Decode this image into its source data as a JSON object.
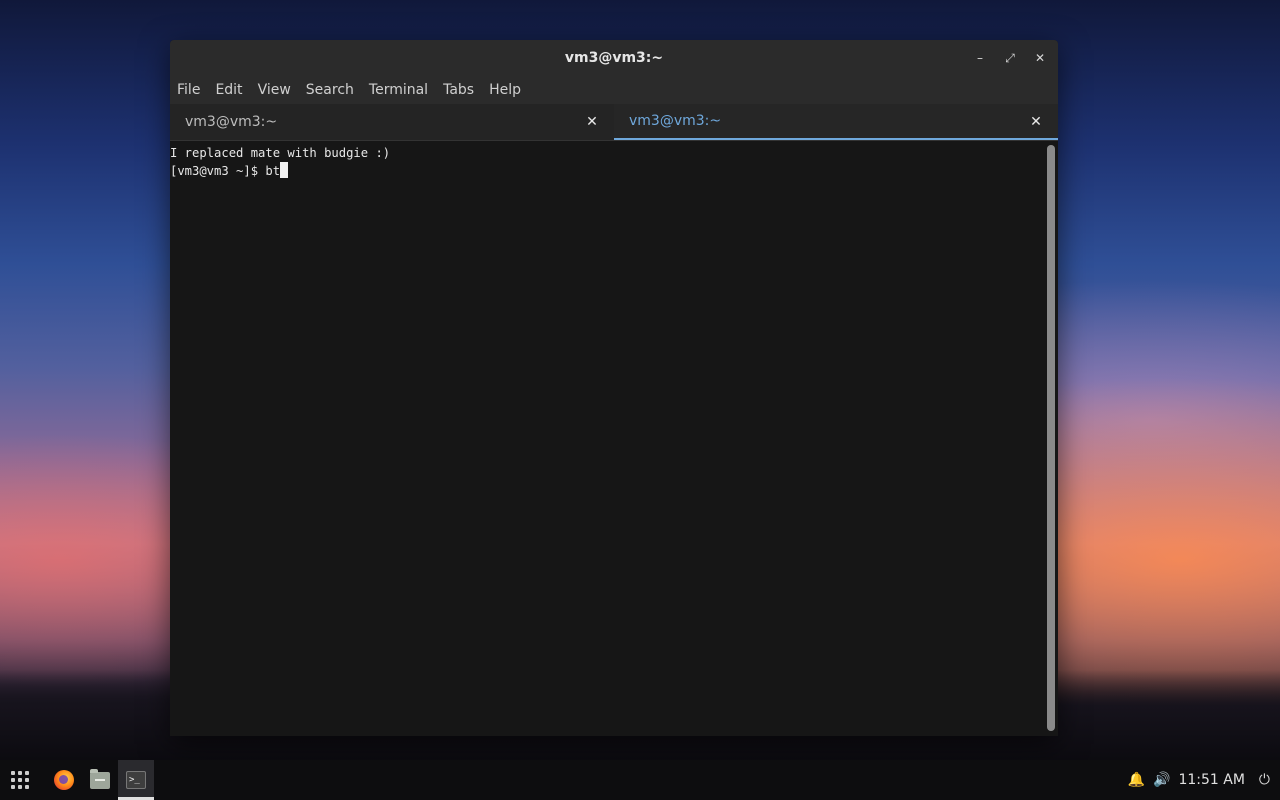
{
  "window": {
    "title": "vm3@vm3:~",
    "controls": {
      "minimize": "–",
      "maximize": "⤢",
      "close": "✕"
    }
  },
  "menubar": {
    "items": [
      {
        "label": "File"
      },
      {
        "label": "Edit"
      },
      {
        "label": "View"
      },
      {
        "label": "Search"
      },
      {
        "label": "Terminal"
      },
      {
        "label": "Tabs"
      },
      {
        "label": "Help"
      }
    ]
  },
  "tabs": [
    {
      "label": "vm3@vm3:~",
      "close": "✕",
      "active": false
    },
    {
      "label": "vm3@vm3:~",
      "close": "✕",
      "active": true
    }
  ],
  "terminal": {
    "lines": [
      "I replaced mate with budgie :)",
      "[vm3@vm3 ~]$ bt"
    ]
  },
  "taskbar": {
    "apps": [
      {
        "name": "app-menu",
        "icon": "grid-icon"
      },
      {
        "name": "firefox",
        "icon": "firefox-icon"
      },
      {
        "name": "files",
        "icon": "files-icon"
      },
      {
        "name": "terminal",
        "icon": "terminal-icon",
        "active": true,
        "glyph": ">_"
      }
    ],
    "tray": {
      "bell": "🔔",
      "volume": "🔊",
      "clock": "11:51 AM",
      "power": "⏻"
    }
  },
  "colors": {
    "accent": "#6fa8dc",
    "terminal_bg": "#161616",
    "chrome_bg": "#2b2b2b"
  }
}
